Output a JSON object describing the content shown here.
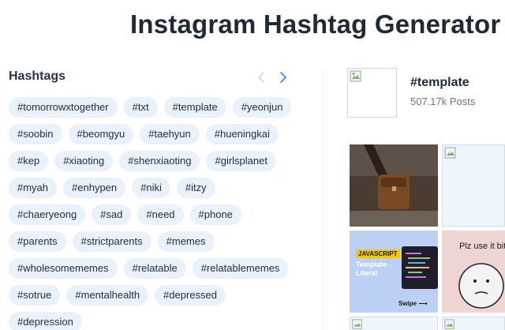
{
  "page": {
    "title": "Instagram Hashtag Generator"
  },
  "hashtags_panel": {
    "heading": "Hashtags",
    "prev_icon": "chevron-left-icon",
    "next_icon": "chevron-right-icon",
    "tags": [
      "#tomorrowxtogether",
      "#txt",
      "#template",
      "#yeonjun",
      "#soobin",
      "#beomgyu",
      "#taehyun",
      "#hueningkai",
      "#kep",
      "#xiaoting",
      "#shenxiaoting",
      "#girlsplanet",
      "#myah",
      "#enhypen",
      "#niki",
      "#itzy",
      "#chaeryeong",
      "#sad",
      "#need",
      "#phone",
      "#parents",
      "#strictparents",
      "#memes",
      "#wholesomememes",
      "#relatable",
      "#relatablememes",
      "#sotrue",
      "#mentalhealth",
      "#depressed",
      "#depression"
    ]
  },
  "tag_detail": {
    "name": "#template",
    "posts": "507.17k Posts",
    "image_icon": "broken-image-icon"
  },
  "posts_grid": {
    "js_card": {
      "title": "JAVASCRIPT",
      "subtitle_line1": "Template",
      "subtitle_line2": "Literal",
      "swipe": "Swipe"
    },
    "meme_text": "Plz use it bit"
  },
  "colors": {
    "chip_bg": "#e9f1fb",
    "text_dark": "#1e2a36",
    "muted": "#6b7785",
    "arrow_active": "#4a7fd4",
    "arrow_inactive": "#c9d6ea"
  }
}
